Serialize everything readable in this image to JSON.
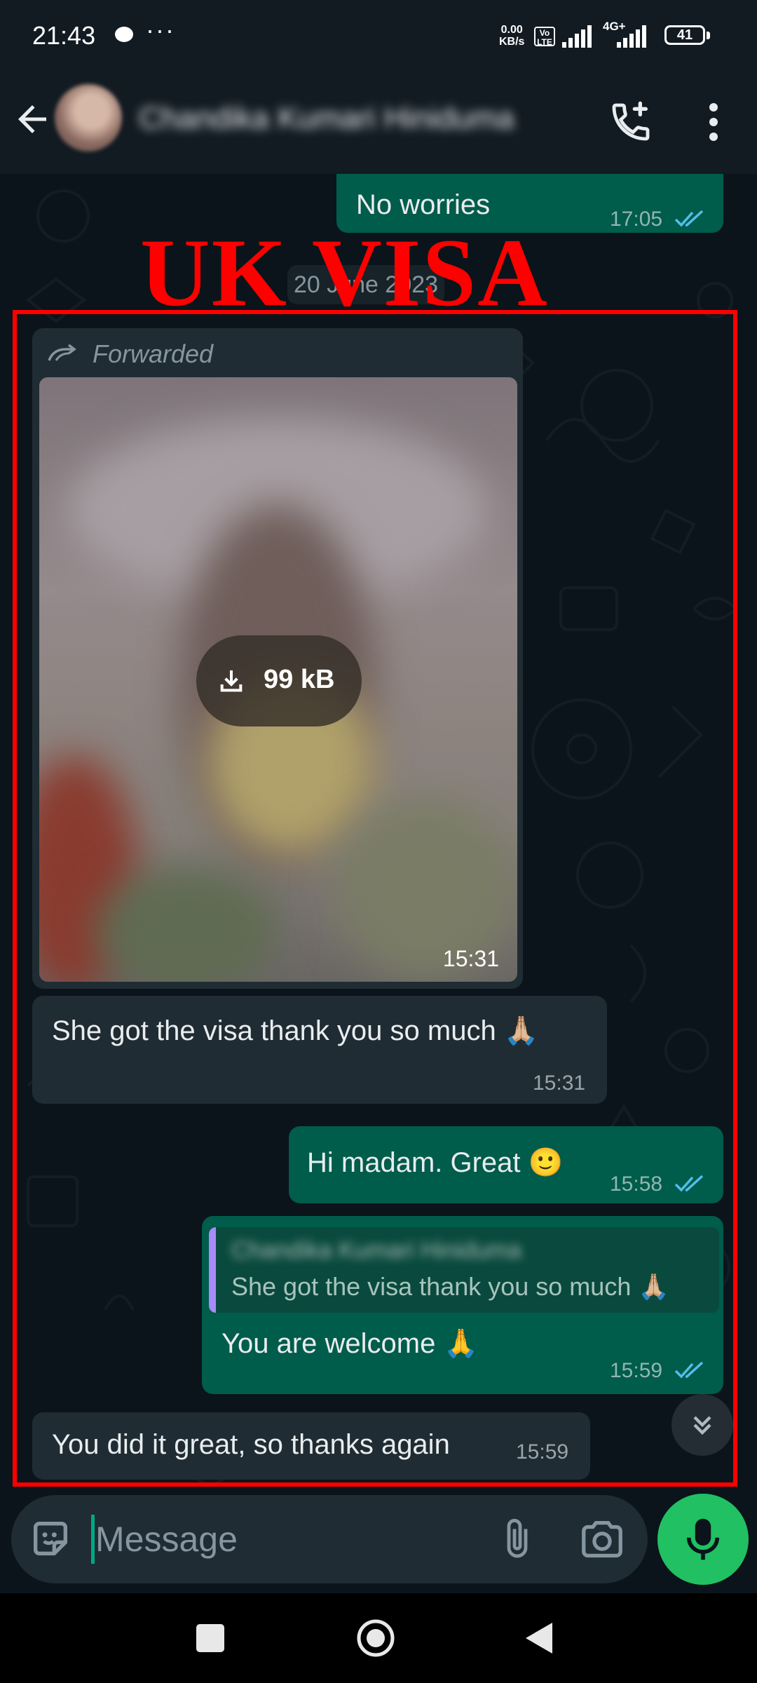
{
  "status_bar": {
    "time": "21:43",
    "dots": "···",
    "net_speed_value": "0.00",
    "net_speed_unit": "KB/s",
    "volte": "Vo LTE",
    "network_type": "4G+",
    "battery": "41"
  },
  "header": {
    "contact_name": "Chandika Kumari Hiniduma"
  },
  "overlay": {
    "label": "UK VISA"
  },
  "chat": {
    "date_chip": "20 June 2023",
    "messages": [
      {
        "direction": "outgoing",
        "text": "No worries",
        "time": "17:05",
        "status": "read"
      },
      {
        "direction": "incoming",
        "forwarded_label": "Forwarded",
        "media": "image",
        "download_size": "99 kB",
        "time": "15:31"
      },
      {
        "direction": "incoming",
        "text": "She got the visa thank you so much 🙏🏼",
        "time": "15:31"
      },
      {
        "direction": "outgoing",
        "text": "Hi madam. Great 🙂",
        "time": "15:58",
        "status": "read"
      },
      {
        "direction": "outgoing",
        "reply_to": {
          "name": "Chandika Kumari Hiniduma",
          "text": "She got the visa thank you so much 🙏🏼"
        },
        "text": "You are welcome 🙏",
        "time": "15:59",
        "status": "read"
      },
      {
        "direction": "incoming",
        "text": "You did it great, so thanks again",
        "time": "15:59"
      }
    ]
  },
  "composer": {
    "placeholder": "Message"
  },
  "colors": {
    "outgoing_bubble": "#005c4b",
    "incoming_bubble": "#202c33",
    "read_ticks": "#53bdeb",
    "mic_button": "#21c063",
    "annotation_red": "#ff0000"
  },
  "icons": [
    "back-arrow-icon",
    "add-call-icon",
    "more-vert-icon",
    "forward-icon",
    "download-icon",
    "double-check-icon",
    "scroll-down-icon",
    "sticker-icon",
    "attach-icon",
    "camera-icon",
    "mic-icon",
    "nav-recent-icon",
    "nav-home-icon",
    "nav-back-icon"
  ]
}
